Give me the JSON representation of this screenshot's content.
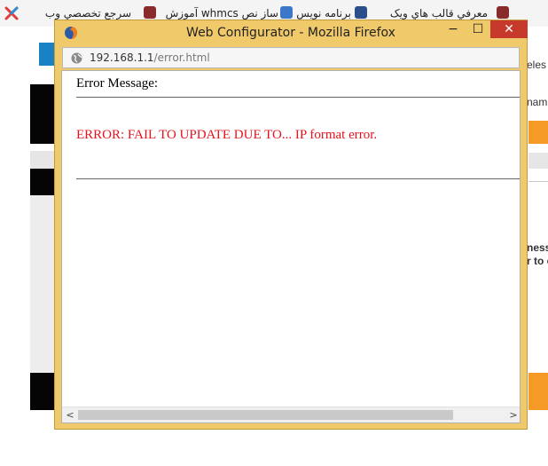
{
  "background": {
    "bookmarks": [
      {
        "label": "سرجع تخصصي وب"
      },
      {
        "label": "ساز نص whmcs آموزش"
      },
      {
        "label": "برنامه نويس"
      },
      {
        "label": "معرفي قالب هاي ويک"
      }
    ],
    "right_texts": [
      "eles",
      "nam",
      "ness",
      "r to c"
    ],
    "colors": {
      "accent": "#f59a27",
      "logo": "#1a82c4"
    }
  },
  "popup": {
    "title": "Web Configurator - Mozilla Firefox",
    "url_host": "192.168.1.1",
    "url_path": "/error.html",
    "controls": {
      "minimize": "−",
      "maximize": "☐",
      "close": "✕"
    },
    "content": {
      "label": "Error Message:",
      "error": "ERROR: FAIL TO UPDATE DUE TO... IP format error."
    },
    "scroll": {
      "left": "<",
      "right": ">"
    },
    "colors": {
      "frame": "#f0c96a",
      "close_button": "#c7392b",
      "error_text": "#e8121c"
    }
  }
}
